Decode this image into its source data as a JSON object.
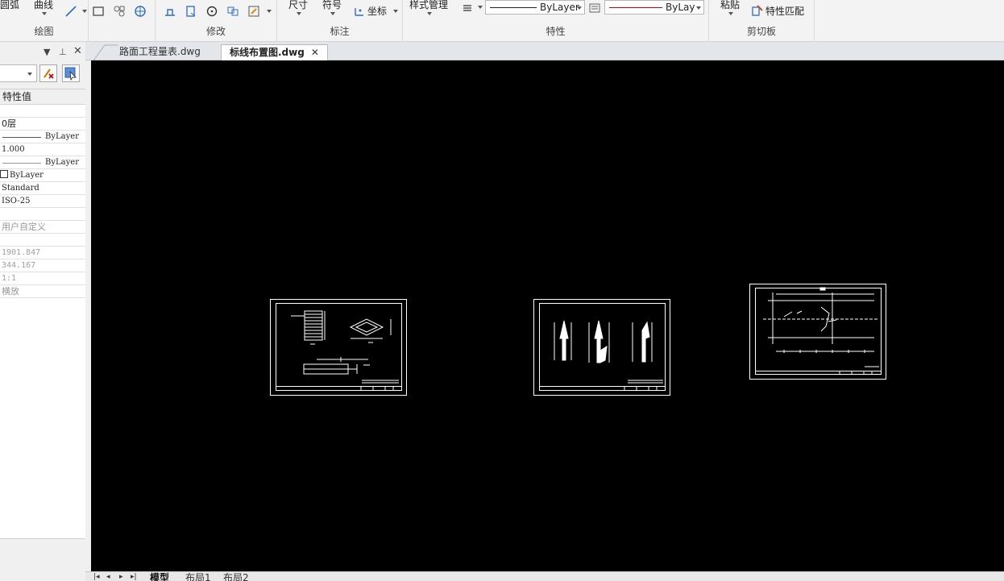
{
  "ribbon": {
    "draw": {
      "arc": "圆弧",
      "curve": "曲线",
      "label": "绘图"
    },
    "modify": {
      "label": "修改"
    },
    "annotate": {
      "dimension": "尺寸",
      "symbol": "符号",
      "coordinate": "坐标",
      "label": "标注"
    },
    "properties": {
      "style_manager": "样式管理",
      "linetype_value": "ByLayer",
      "color_value": "ByLay",
      "label": "特性"
    },
    "clipboard": {
      "paste": "粘贴",
      "match_properties": "特性匹配",
      "label": "剪切板"
    }
  },
  "properties_panel": {
    "header": "特性值",
    "rows": {
      "layer": "0层",
      "linetype": "ByLayer",
      "linetype_scale": "1.000",
      "lineweight": "ByLayer",
      "color": "ByLayer",
      "text_style": "Standard",
      "dim_style": "ISO-25",
      "ucs_name": "用户自定义",
      "coord_x": "1901.847",
      "coord_y": "344.167",
      "scale": "1:1",
      "orientation": "横放"
    }
  },
  "document_tabs": [
    {
      "label": "路面工程量表.dwg"
    },
    {
      "label": "标线布置图.dwg",
      "close": "✕"
    }
  ],
  "layout_tabs": [
    {
      "label": "模型"
    },
    {
      "label": "布局1"
    },
    {
      "label": "布局2"
    }
  ],
  "colors": {
    "canvas": "#000000",
    "drawing_lines": "#ffffff",
    "ribbon_bg": "#f3f3f3",
    "color_line_red": "#cc0000"
  }
}
